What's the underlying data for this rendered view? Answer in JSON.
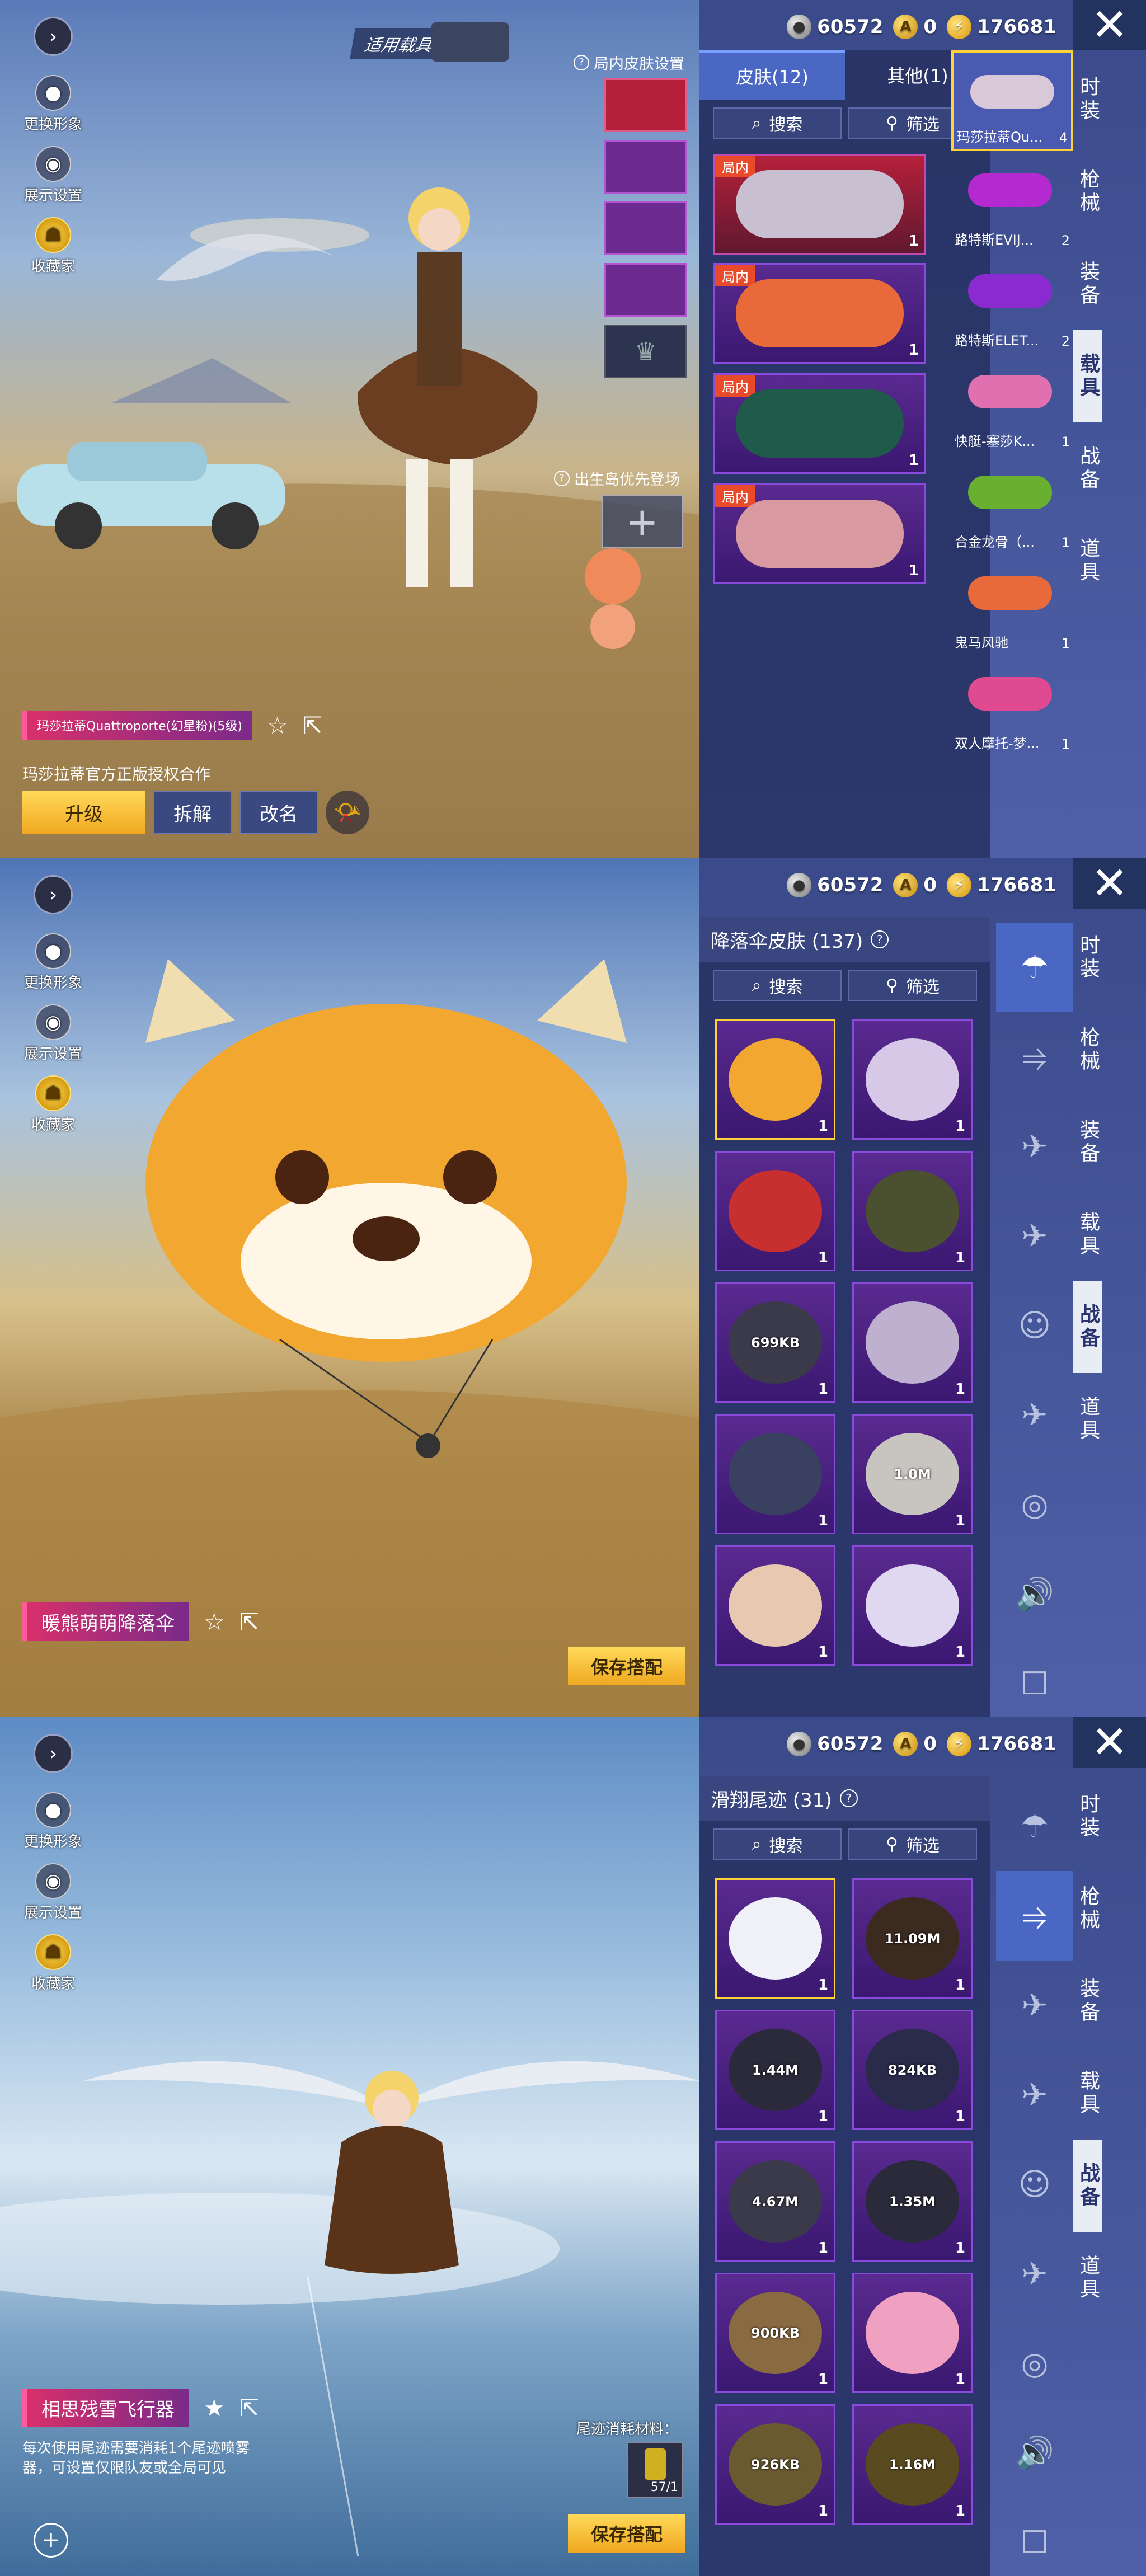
{
  "currency": {
    "silver": "60572",
    "ag": "0",
    "uc": "176681"
  },
  "close_glyph": "✕",
  "left_buttons": {
    "change_look": "更换形象",
    "display_settings": "展示设置",
    "collector": "收藏家"
  },
  "right_nav": [
    "时装",
    "枪械",
    "装备",
    "载具",
    "战备",
    "道具"
  ],
  "panel1": {
    "active_nav": 3,
    "applied_vehicle_label": "适用载具",
    "in_match_skin_setting": "局内皮肤设置",
    "birth_island_label": "出生岛优先登场",
    "tabs": [
      {
        "label": "皮肤(12)"
      },
      {
        "label": "其他(1)"
      }
    ],
    "search": "搜索",
    "filter": "筛选",
    "tiles": [
      {
        "tag": "局内",
        "count": "1"
      },
      {
        "tag": "局内",
        "count": "1"
      },
      {
        "tag": "局内",
        "count": "1"
      },
      {
        "tag": "局内",
        "count": "1"
      }
    ],
    "side_list": [
      {
        "name": "玛莎拉蒂Qu...",
        "count": "4"
      },
      {
        "name": "路特斯EVIJ...",
        "count": "2"
      },
      {
        "name": "路特斯ELET...",
        "count": "2"
      },
      {
        "name": "快艇-塞莎K...",
        "count": "1"
      },
      {
        "name": "合金龙骨（...",
        "count": "1"
      },
      {
        "name": "鬼马风驰",
        "count": "1"
      },
      {
        "name": "双人摩托-梦...",
        "count": "1"
      }
    ],
    "item_name": "玛莎拉蒂Quattroporte(幻星粉)(5级)",
    "licence": "玛莎拉蒂官方正版授权合作",
    "btn_upgrade": "升级",
    "btn_dismantle": "拆解",
    "btn_rename": "改名"
  },
  "panel2": {
    "active_nav": 4,
    "title": "降落伞皮肤 (137)",
    "search": "搜索",
    "filter": "筛选",
    "tiles": [
      {
        "count": "1",
        "dl": ""
      },
      {
        "count": "1",
        "dl": ""
      },
      {
        "count": "1",
        "dl": ""
      },
      {
        "count": "1",
        "dl": ""
      },
      {
        "count": "1",
        "dl": "699KB"
      },
      {
        "count": "1",
        "dl": ""
      },
      {
        "count": "1",
        "dl": ""
      },
      {
        "count": "1",
        "dl": "1.0M"
      },
      {
        "count": "1",
        "dl": ""
      },
      {
        "count": "1",
        "dl": ""
      }
    ],
    "item_name": "暖熊萌萌降落伞",
    "save": "保存搭配"
  },
  "panel3": {
    "active_nav": 4,
    "title": "滑翔尾迹 (31)",
    "search": "搜索",
    "filter": "筛选",
    "tiles": [
      {
        "count": "1",
        "dl": ""
      },
      {
        "count": "1",
        "dl": "11.09M"
      },
      {
        "count": "1",
        "dl": "1.44M"
      },
      {
        "count": "1",
        "dl": "824KB"
      },
      {
        "count": "1",
        "dl": "4.67M"
      },
      {
        "count": "1",
        "dl": "1.35M"
      },
      {
        "count": "1",
        "dl": "900KB"
      },
      {
        "count": "1",
        "dl": ""
      },
      {
        "count": "1",
        "dl": "926KB"
      },
      {
        "count": "1",
        "dl": "1.16M"
      }
    ],
    "item_name": "相思残雪飞行器",
    "desc": "每次使用尾迹需要消耗1个尾迹喷雾器，可设置仅限队友或全局可见",
    "material_label": "尾迹消耗材料：",
    "material_count": "57/1",
    "save": "保存搭配"
  }
}
